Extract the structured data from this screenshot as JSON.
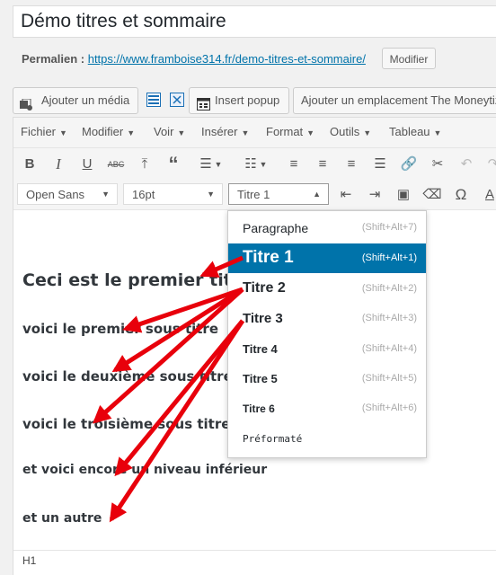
{
  "post": {
    "title": "Démo titres et sommaire",
    "permalink_label": "Permalien :",
    "permalink_url": "https://www.framboise314.fr/demo-titres-et-sommaire/",
    "permalink_button": "Modifier"
  },
  "media_bar": {
    "add_media": "Ajouter un média",
    "insert_popup": "Insert popup",
    "moneytizer": "Ajouter un emplacement The Moneytiz"
  },
  "menubar": [
    "Fichier",
    "Modifier",
    "Voir",
    "Insérer",
    "Format",
    "Outils",
    "Tableau"
  ],
  "toolbar": {
    "font_family": "Open Sans",
    "font_size": "16pt",
    "block_format": "Titre 1",
    "icons": [
      "bold-icon",
      "italic-icon",
      "underline-icon",
      "strikethrough-icon",
      "insert-icon",
      "blockquote-icon",
      "bullet-list-icon",
      "numbered-list-icon",
      "align-left-icon",
      "align-center-icon",
      "align-right-icon",
      "justify-icon",
      "link-icon",
      "unlink-icon",
      "undo-icon",
      "redo-icon",
      "outdent-icon",
      "indent-icon",
      "paste-text-icon",
      "clear-format-icon",
      "omega-icon",
      "text-color-icon"
    ]
  },
  "content": {
    "h1": "Ceci est le premier titre",
    "h2": "voici le premier sous titre",
    "h3a": "voici le deuxième sous titre",
    "h3b": "voici le troisième sous titre",
    "h4": "et voici encore un niveau inférieur",
    "h5": "et un autre"
  },
  "dropdown": {
    "items": [
      {
        "label": "Paragraphe",
        "shortcut": "(Shift+Alt+7)"
      },
      {
        "label": "Titre 1",
        "shortcut": "(Shift+Alt+1)"
      },
      {
        "label": "Titre 2",
        "shortcut": "(Shift+Alt+2)"
      },
      {
        "label": "Titre 3",
        "shortcut": "(Shift+Alt+3)"
      },
      {
        "label": "Titre 4",
        "shortcut": "(Shift+Alt+4)"
      },
      {
        "label": "Titre 5",
        "shortcut": "(Shift+Alt+5)"
      },
      {
        "label": "Titre 6",
        "shortcut": "(Shift+Alt+6)"
      },
      {
        "label": "Préformaté",
        "shortcut": ""
      }
    ],
    "active": "Titre 1"
  },
  "status": {
    "path": "H1"
  },
  "colors": {
    "accent": "#0073aa",
    "arrow": "#e8000b"
  }
}
